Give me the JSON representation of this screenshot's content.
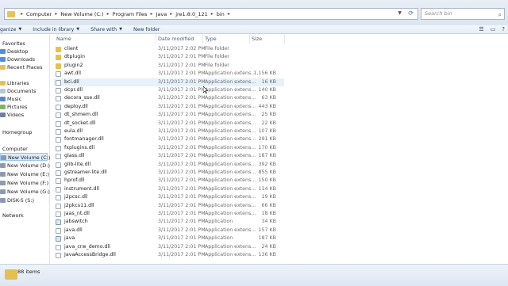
{
  "address": {
    "crumbs": [
      "Computer",
      "New Volume (C:)",
      "Program Files",
      "Java",
      "jre1.8.0_121",
      "bin"
    ],
    "search_placeholder": "Search bin"
  },
  "toolbar": {
    "organize": "ganize",
    "include": "Include in library",
    "share": "Share with",
    "newfolder": "New folder"
  },
  "nav": {
    "favorites": "Favorites",
    "desktop": "Desktop",
    "downloads": "Downloads",
    "recent": "Recent Places",
    "libraries": "Libraries",
    "documents": "Documents",
    "music": "Music",
    "pictures": "Pictures",
    "videos": "Videos",
    "homegroup": "Homegroup",
    "computer": "Computer",
    "vol_c": "New Volume (C:)",
    "vol_d": "New Volume (D:)",
    "vol_e": "New Volume (E:)",
    "vol_f": "New Volume (F:)",
    "vol_g": "New Volume (G:)",
    "disk_s": "DISK-S (S:)",
    "network": "Network"
  },
  "columns": {
    "name": "Name",
    "date": "Date modified",
    "type": "Type",
    "size": "Size"
  },
  "rows": [
    {
      "name": "client",
      "date": "3/11/2017 2:02 PM",
      "type": "File folder",
      "size": "",
      "icon": "folder"
    },
    {
      "name": "dtplugin",
      "date": "3/11/2017 2:01 PM",
      "type": "File folder",
      "size": "",
      "icon": "folder"
    },
    {
      "name": "plugin2",
      "date": "3/11/2017 2:01 PM",
      "type": "File folder",
      "size": "",
      "icon": "folder"
    },
    {
      "name": "awt.dll",
      "date": "3/11/2017 2:01 PM",
      "type": "Application extens...",
      "size": "1,156 KB",
      "icon": "file"
    },
    {
      "name": "bci.dll",
      "date": "3/11/2017 2:01 PM",
      "type": "Application extens...",
      "size": "16 KB",
      "icon": "file"
    },
    {
      "name": "dcpr.dll",
      "date": "3/11/2017 2:01 PM",
      "type": "Application extens...",
      "size": "140 KB",
      "icon": "file"
    },
    {
      "name": "decora_sse.dll",
      "date": "3/11/2017 2:01 PM",
      "type": "Application extens...",
      "size": "63 KB",
      "icon": "file"
    },
    {
      "name": "deploy.dll",
      "date": "3/11/2017 2:01 PM",
      "type": "Application extens...",
      "size": "443 KB",
      "icon": "file"
    },
    {
      "name": "dt_shmem.dll",
      "date": "3/11/2017 2:01 PM",
      "type": "Application extens...",
      "size": "25 KB",
      "icon": "file"
    },
    {
      "name": "dt_socket.dll",
      "date": "3/11/2017 2:01 PM",
      "type": "Application extens...",
      "size": "22 KB",
      "icon": "file"
    },
    {
      "name": "eula.dll",
      "date": "3/11/2017 2:01 PM",
      "type": "Application extens...",
      "size": "107 KB",
      "icon": "file"
    },
    {
      "name": "fontmanager.dll",
      "date": "3/11/2017 2:01 PM",
      "type": "Application extens...",
      "size": "291 KB",
      "icon": "file"
    },
    {
      "name": "fxplugins.dll",
      "date": "3/11/2017 2:01 PM",
      "type": "Application extens...",
      "size": "170 KB",
      "icon": "file"
    },
    {
      "name": "glass.dll",
      "date": "3/11/2017 2:01 PM",
      "type": "Application extens...",
      "size": "187 KB",
      "icon": "file"
    },
    {
      "name": "glib-lite.dll",
      "date": "3/11/2017 2:01 PM",
      "type": "Application extens...",
      "size": "392 KB",
      "icon": "file"
    },
    {
      "name": "gstreamer-lite.dll",
      "date": "3/11/2017 2:01 PM",
      "type": "Application extens...",
      "size": "855 KB",
      "icon": "file"
    },
    {
      "name": "hprof.dll",
      "date": "3/11/2017 2:01 PM",
      "type": "Application extens...",
      "size": "150 KB",
      "icon": "file"
    },
    {
      "name": "instrument.dll",
      "date": "3/11/2017 2:01 PM",
      "type": "Application extens...",
      "size": "114 KB",
      "icon": "file"
    },
    {
      "name": "j2pcsc.dll",
      "date": "3/11/2017 2:01 PM",
      "type": "Application extens...",
      "size": "19 KB",
      "icon": "file"
    },
    {
      "name": "j2pkcs11.dll",
      "date": "3/11/2017 2:01 PM",
      "type": "Application extens...",
      "size": "66 KB",
      "icon": "file"
    },
    {
      "name": "jaas_nt.dll",
      "date": "3/11/2017 2:01 PM",
      "type": "Application extens...",
      "size": "18 KB",
      "icon": "file"
    },
    {
      "name": "jabswitch",
      "date": "3/11/2017 2:01 PM",
      "type": "Application",
      "size": "34 KB",
      "icon": "app"
    },
    {
      "name": "java.dll",
      "date": "3/11/2017 2:01 PM",
      "type": "Application extens...",
      "size": "157 KB",
      "icon": "file"
    },
    {
      "name": "java",
      "date": "3/11/2017 2:01 PM",
      "type": "Application",
      "size": "187 KB",
      "icon": "app"
    },
    {
      "name": "java_crw_demo.dll",
      "date": "3/11/2017 2:01 PM",
      "type": "Application extens...",
      "size": "24 KB",
      "icon": "file"
    },
    {
      "name": "JavaAccessBridge.dll",
      "date": "3/11/2017 2:01 PM",
      "type": "Application extens...",
      "size": "136 KB",
      "icon": "file"
    }
  ],
  "status": {
    "count": "88 items"
  }
}
